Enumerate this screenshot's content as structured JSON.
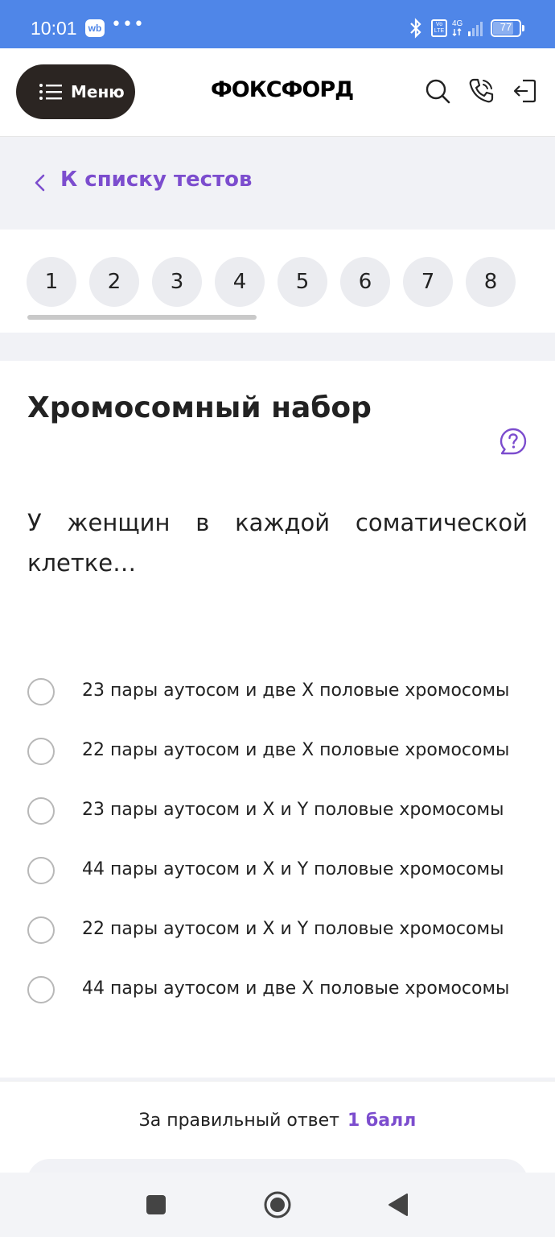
{
  "status_bar": {
    "time": "10:01",
    "app_badge": "wb",
    "more_dots": "•••",
    "volte": "Vo LTE",
    "network": "4G",
    "battery_level": "77",
    "battery_fraction": 0.77
  },
  "header": {
    "menu_label": "Меню",
    "logo": "ФОКСФОРД",
    "icons": [
      "search-icon",
      "phone-icon",
      "logout-icon"
    ]
  },
  "back_link": {
    "label": "К списку тестов"
  },
  "question_nav": {
    "numbers": [
      "1",
      "2",
      "3",
      "4",
      "5",
      "6",
      "7",
      "8"
    ]
  },
  "question": {
    "title": "Хромосомный набор",
    "text": "У женщин в каждой соматической клетке…",
    "options": [
      {
        "num": "23",
        "text": " пары аутосом и две X половые хромосомы"
      },
      {
        "num": "22",
        "text": " пары аутосом и две X половые хромосомы"
      },
      {
        "num": "23",
        "text": " пары аутосом и X и Y половые хромосомы"
      },
      {
        "num": "44",
        "text": " пары аутосом и X и Y половые хромосомы"
      },
      {
        "num": "22",
        "text": " пары аутосом и X и Y половые хромосомы"
      },
      {
        "num": "44",
        "text": " пары аутосом и две X половые хромосомы"
      }
    ]
  },
  "footer": {
    "score_label": "За правильный ответ",
    "score_value": "1 балл"
  },
  "colors": {
    "accent": "#7c4dce",
    "status_bar": "#4f86e8",
    "menu_button": "#2b2522"
  }
}
